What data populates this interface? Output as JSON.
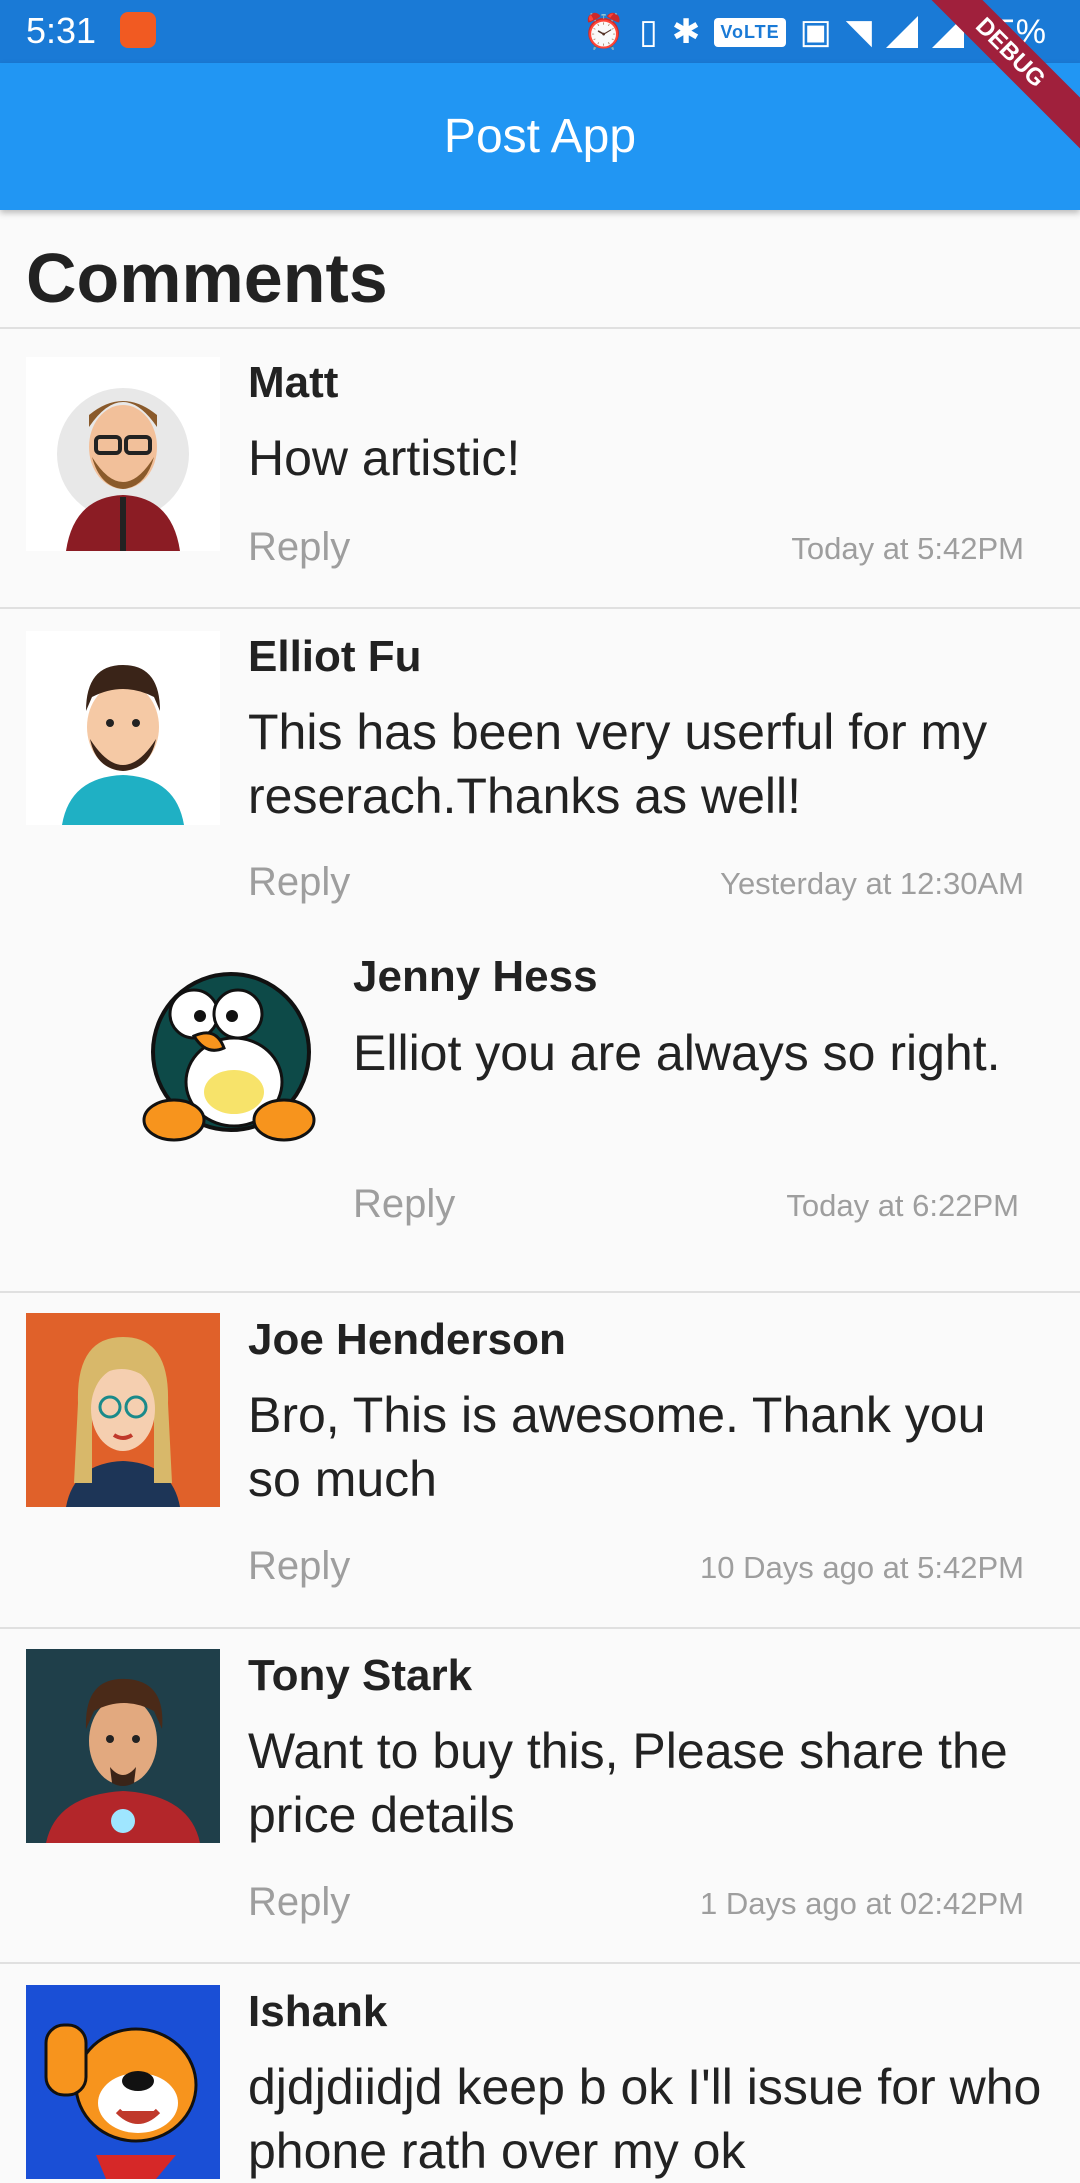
{
  "status_bar": {
    "time": "5:31",
    "battery": "75%",
    "network": "VoLTE"
  },
  "app_bar": {
    "title": "Post App",
    "debug_label": "DEBUG"
  },
  "section": {
    "title": "Comments"
  },
  "comments": [
    {
      "name": "Matt",
      "text": "How artistic!",
      "reply_label": "Reply",
      "time": "Today at 5:42PM"
    },
    {
      "name": "Elliot Fu",
      "text": "This has been very userful for my reserach.Thanks as well!",
      "reply_label": "Reply",
      "time": "Yesterday at 12:30AM"
    },
    {
      "name": "Jenny Hess",
      "text": "Elliot you are always so right.",
      "reply_label": "Reply",
      "time": "Today at 6:22PM"
    },
    {
      "name": "Joe Henderson",
      "text": "Bro, This is awesome. Thank you so much",
      "reply_label": "Reply",
      "time": "10 Days ago at 5:42PM"
    },
    {
      "name": "Tony Stark",
      "text": "Want to buy this, Please share the price details",
      "reply_label": "Reply",
      "time": "1 Days ago at 02:42PM"
    },
    {
      "name": "Ishank",
      "text": "djdjdiidjd keep b ok I'll issue for who phone rath over my ok"
    }
  ],
  "colors": {
    "status_bar": "#1a7ad6",
    "app_bar": "#2196f3",
    "debug": "#a0203c",
    "muted": "#9e9e9e"
  }
}
